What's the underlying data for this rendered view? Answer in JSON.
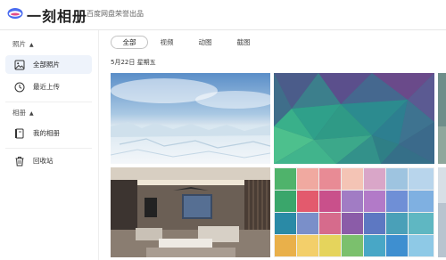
{
  "header": {
    "app_name": "一刻相册",
    "tagline": "百度网盘荣誉出品"
  },
  "sidebar": {
    "photos_section": "照片",
    "albums_section": "相册",
    "items": [
      {
        "label": "全部照片",
        "icon": "image-icon",
        "active": true
      },
      {
        "label": "最近上传",
        "icon": "clock-icon",
        "active": false
      },
      {
        "label": "我的相册",
        "icon": "album-icon",
        "active": false
      },
      {
        "label": "回收站",
        "icon": "trash-icon",
        "active": false
      }
    ]
  },
  "main": {
    "tabs": [
      {
        "label": "全部",
        "active": true
      },
      {
        "label": "视频",
        "active": false
      },
      {
        "label": "动图",
        "active": false
      },
      {
        "label": "截图",
        "active": false
      }
    ],
    "date_group": "5月22日 星期五",
    "photos": [
      {
        "subject": "frozen-lake-landscape"
      },
      {
        "subject": "teal-low-poly-pattern"
      },
      {
        "subject": "partial-image-edge"
      },
      {
        "subject": "modern-living-room"
      },
      {
        "subject": "color-swatch-grid"
      },
      {
        "subject": "partial-image-edge"
      }
    ]
  },
  "colors": {
    "accent_active_bg": "#eef3fb",
    "divider": "#eeeeee"
  }
}
